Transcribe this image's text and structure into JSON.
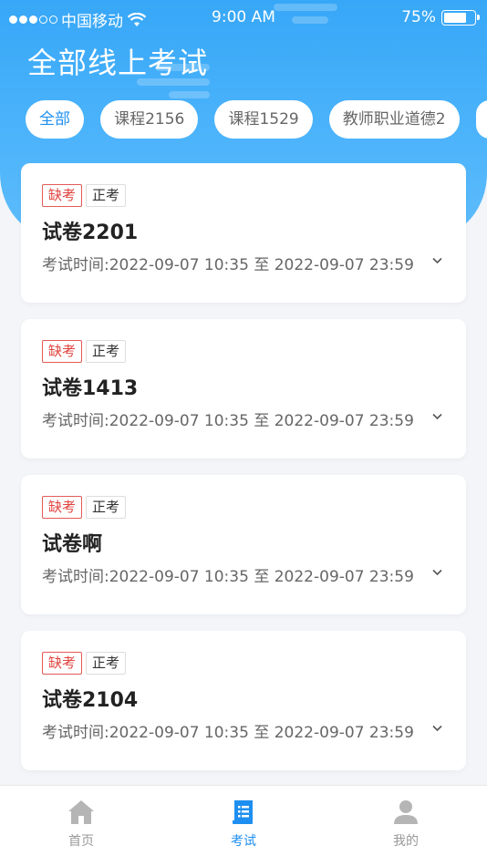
{
  "status_bar": {
    "carrier": "中国移动",
    "time": "9:00 AM",
    "battery": "75%",
    "battery_level": 0.75
  },
  "header": {
    "title": "全部线上考试"
  },
  "filters": [
    {
      "label": "全部",
      "active": true
    },
    {
      "label": "课程2156",
      "active": false
    },
    {
      "label": "课程1529",
      "active": false
    },
    {
      "label": "教师职业道德2",
      "active": false
    }
  ],
  "exams": [
    {
      "status_tag": "缺考",
      "type_tag": "正考",
      "title": "试卷2201",
      "time": "考试时间:2022-09-07 10:35 至 2022-09-07 23:59"
    },
    {
      "status_tag": "缺考",
      "type_tag": "正考",
      "title": "试卷1413",
      "time": "考试时间:2022-09-07 10:35 至 2022-09-07 23:59"
    },
    {
      "status_tag": "缺考",
      "type_tag": "正考",
      "title": "试卷啊",
      "time": "考试时间:2022-09-07 10:35 至 2022-09-07 23:59"
    },
    {
      "status_tag": "缺考",
      "type_tag": "正考",
      "title": "试卷2104",
      "time": "考试时间:2022-09-07 10:35 至 2022-09-07 23:59"
    }
  ],
  "tabbar": [
    {
      "label": "首页",
      "icon": "home-icon",
      "active": false
    },
    {
      "label": "考试",
      "icon": "exam-icon",
      "active": true
    },
    {
      "label": "我的",
      "icon": "user-icon",
      "active": false
    }
  ],
  "colors": {
    "primary": "#1e8ff0",
    "header": "#3fabf9",
    "absent_tag": "#e0443f"
  }
}
